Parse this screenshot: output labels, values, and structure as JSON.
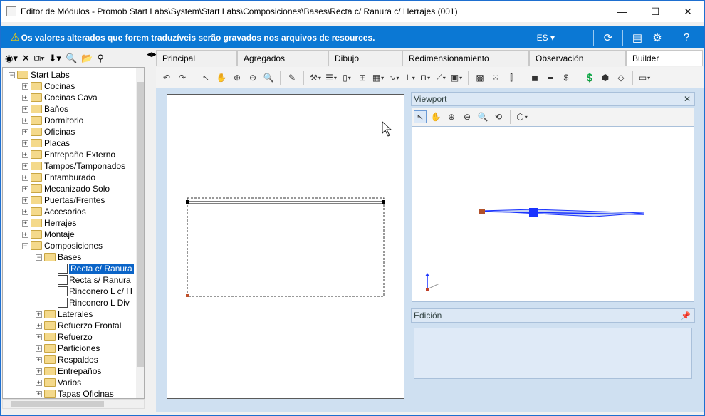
{
  "window": {
    "title": "Editor de Módulos - Promob Start Labs\\System\\Start Labs\\Composiciones\\Bases\\Recta c/ Ranura c/ Herrajes (001)",
    "minimize": "—",
    "maximize": "☐",
    "close": "✕"
  },
  "infobar": {
    "warning_icon": "⚠",
    "message": "Os valores alterados que forem traduzíveis serão gravados nos arquivos de resources.",
    "language": "ES ▾"
  },
  "tree": {
    "items": [
      {
        "label": "Start Labs",
        "level": 0,
        "expander": "−",
        "kind": "folder"
      },
      {
        "label": "Cocinas",
        "level": 1,
        "expander": "+",
        "kind": "folder"
      },
      {
        "label": "Cocinas Cava",
        "level": 1,
        "expander": "+",
        "kind": "folder"
      },
      {
        "label": "Baños",
        "level": 1,
        "expander": "+",
        "kind": "folder"
      },
      {
        "label": "Dormitorio",
        "level": 1,
        "expander": "+",
        "kind": "folder"
      },
      {
        "label": "Oficinas",
        "level": 1,
        "expander": "+",
        "kind": "folder"
      },
      {
        "label": "Placas",
        "level": 1,
        "expander": "+",
        "kind": "folder"
      },
      {
        "label": "Entrepaño Externo",
        "level": 1,
        "expander": "+",
        "kind": "folder"
      },
      {
        "label": "Tampos/Tamponados",
        "level": 1,
        "expander": "+",
        "kind": "folder"
      },
      {
        "label": "Entamburado",
        "level": 1,
        "expander": "+",
        "kind": "folder"
      },
      {
        "label": "Mecanizado Solo",
        "level": 1,
        "expander": "+",
        "kind": "folder"
      },
      {
        "label": "Puertas/Frentes",
        "level": 1,
        "expander": "+",
        "kind": "folder"
      },
      {
        "label": "Accesorios",
        "level": 1,
        "expander": "+",
        "kind": "folder"
      },
      {
        "label": "Herrajes",
        "level": 1,
        "expander": "+",
        "kind": "folder"
      },
      {
        "label": "Montaje",
        "level": 1,
        "expander": "+",
        "kind": "folder"
      },
      {
        "label": "Composiciones",
        "level": 1,
        "expander": "−",
        "kind": "folder"
      },
      {
        "label": "Bases",
        "level": 2,
        "expander": "−",
        "kind": "folder"
      },
      {
        "label": "Recta c/ Ranura",
        "level": 3,
        "expander": "",
        "kind": "doc",
        "selected": true
      },
      {
        "label": "Recta s/ Ranura",
        "level": 3,
        "expander": "",
        "kind": "doc"
      },
      {
        "label": "Rinconero L c/ H",
        "level": 3,
        "expander": "",
        "kind": "doc"
      },
      {
        "label": "Rinconero L Div",
        "level": 3,
        "expander": "",
        "kind": "doc"
      },
      {
        "label": "Laterales",
        "level": 2,
        "expander": "+",
        "kind": "folder"
      },
      {
        "label": "Refuerzo Frontal",
        "level": 2,
        "expander": "+",
        "kind": "folder"
      },
      {
        "label": "Refuerzo",
        "level": 2,
        "expander": "+",
        "kind": "folder"
      },
      {
        "label": "Particiones",
        "level": 2,
        "expander": "+",
        "kind": "folder"
      },
      {
        "label": "Respaldos",
        "level": 2,
        "expander": "+",
        "kind": "folder"
      },
      {
        "label": "Entrepaños",
        "level": 2,
        "expander": "+",
        "kind": "folder"
      },
      {
        "label": "Varios",
        "level": 2,
        "expander": "+",
        "kind": "folder"
      },
      {
        "label": "Tapas Oficinas",
        "level": 2,
        "expander": "+",
        "kind": "folder"
      }
    ]
  },
  "tabs": [
    "Principal",
    "Agregados",
    "Dibujo",
    "Redimensionamiento",
    "Observación",
    "Builder"
  ],
  "active_tab": "Builder",
  "viewport": {
    "title": "Viewport",
    "close": "✕"
  },
  "edicion": {
    "title": "Edición",
    "pin": "📌"
  },
  "colors": {
    "infobar": "#0b78d4",
    "selection": "#0a64c8",
    "panel_bg": "#cfe0f1",
    "accent_blue": "#1a33ff"
  }
}
